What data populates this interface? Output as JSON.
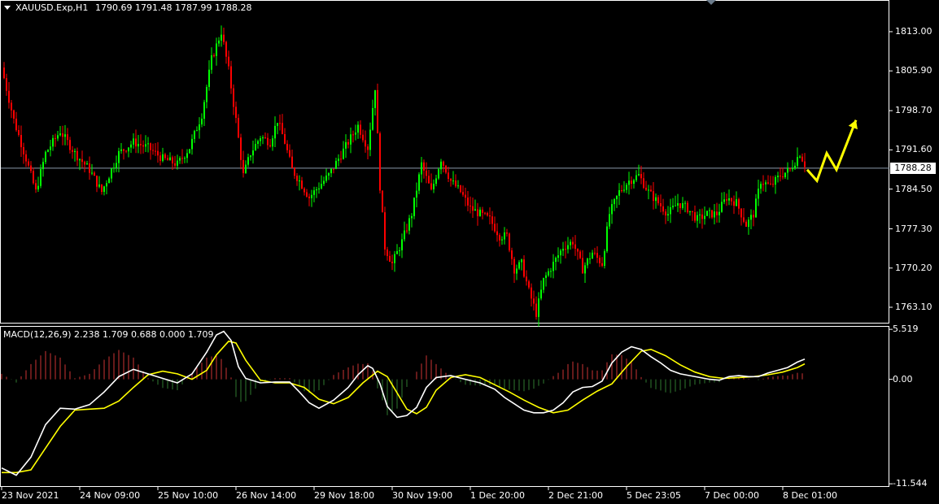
{
  "main_header": {
    "symbol": "XAUUSD.Exp,H1",
    "ohlc": "1790.69 1791.48 1787.99 1788.28"
  },
  "macd_header": {
    "text": "MACD(12,26,9) 2.238 1.709 0.688 0.000 1.709"
  },
  "current_price_label": "1788.28",
  "colors": {
    "background": "#000000",
    "bull_candle": "#00ff00",
    "bear_candle": "#ff0000",
    "macd_line": "#ffffff",
    "signal_line": "#ffff00",
    "hist_pos": "#cc3333",
    "hist_neg": "#2f7a2f",
    "grid_frame": "#ffffff",
    "forecast_arrow": "#ffff00"
  },
  "chart_data": [
    {
      "type": "candlestick",
      "symbol": "XAUUSD.Exp",
      "timeframe": "H1",
      "y_ticks": [
        "1813.00",
        "1805.90",
        "1798.70",
        "1791.60",
        "1784.50",
        "1777.30",
        "1770.20",
        "1763.10"
      ],
      "ylim": [
        1760.3,
        1818.0
      ],
      "x_ticks": [
        "23 Nov 2021",
        "24 Nov 09:00",
        "25 Nov 10:00",
        "26 Nov 14:00",
        "29 Nov 18:00",
        "30 Nov 19:00",
        "1 Dec 20:00",
        "2 Dec 21:00",
        "5 Dec 23:05",
        "7 Dec 00:00",
        "8 Dec 01:00"
      ],
      "current_price": 1788.28,
      "close_path": [
        {
          "bar": 0,
          "price": 1806.5
        },
        {
          "bar": 5,
          "price": 1797
        },
        {
          "bar": 10,
          "price": 1790
        },
        {
          "bar": 14,
          "price": 1784
        },
        {
          "bar": 18,
          "price": 1791
        },
        {
          "bar": 24,
          "price": 1795
        },
        {
          "bar": 30,
          "price": 1791
        },
        {
          "bar": 36,
          "price": 1788
        },
        {
          "bar": 41,
          "price": 1784
        },
        {
          "bar": 44,
          "price": 1787
        },
        {
          "bar": 48,
          "price": 1791
        },
        {
          "bar": 54,
          "price": 1793
        },
        {
          "bar": 60,
          "price": 1792
        },
        {
          "bar": 66,
          "price": 1790
        },
        {
          "bar": 72,
          "price": 1789
        },
        {
          "bar": 77,
          "price": 1792
        },
        {
          "bar": 82,
          "price": 1798
        },
        {
          "bar": 86,
          "price": 1808
        },
        {
          "bar": 90,
          "price": 1813
        },
        {
          "bar": 93,
          "price": 1806
        },
        {
          "bar": 96,
          "price": 1797
        },
        {
          "bar": 99,
          "price": 1787
        },
        {
          "bar": 102,
          "price": 1791
        },
        {
          "bar": 106,
          "price": 1794
        },
        {
          "bar": 110,
          "price": 1793
        },
        {
          "bar": 113,
          "price": 1797
        },
        {
          "bar": 116,
          "price": 1793
        },
        {
          "bar": 119,
          "price": 1788
        },
        {
          "bar": 122,
          "price": 1786
        },
        {
          "bar": 126,
          "price": 1783
        },
        {
          "bar": 130,
          "price": 1785
        },
        {
          "bar": 134,
          "price": 1787
        },
        {
          "bar": 138,
          "price": 1790
        },
        {
          "bar": 142,
          "price": 1793
        },
        {
          "bar": 146,
          "price": 1796
        },
        {
          "bar": 150,
          "price": 1792
        },
        {
          "bar": 153,
          "price": 1803
        },
        {
          "bar": 155,
          "price": 1785
        },
        {
          "bar": 157,
          "price": 1774
        },
        {
          "bar": 160,
          "price": 1771
        },
        {
          "bar": 164,
          "price": 1775
        },
        {
          "bar": 168,
          "price": 1780
        },
        {
          "bar": 172,
          "price": 1789
        },
        {
          "bar": 176,
          "price": 1784
        },
        {
          "bar": 180,
          "price": 1790
        },
        {
          "bar": 184,
          "price": 1786
        },
        {
          "bar": 188,
          "price": 1784
        },
        {
          "bar": 192,
          "price": 1781
        },
        {
          "bar": 196,
          "price": 1780
        },
        {
          "bar": 200,
          "price": 1779
        },
        {
          "bar": 204,
          "price": 1776
        },
        {
          "bar": 207,
          "price": 1776
        },
        {
          "bar": 210,
          "price": 1770
        },
        {
          "bar": 213,
          "price": 1771
        },
        {
          "bar": 216,
          "price": 1766
        },
        {
          "bar": 219,
          "price": 1762
        },
        {
          "bar": 222,
          "price": 1768
        },
        {
          "bar": 226,
          "price": 1771
        },
        {
          "bar": 230,
          "price": 1774
        },
        {
          "bar": 234,
          "price": 1775
        },
        {
          "bar": 238,
          "price": 1770
        },
        {
          "bar": 242,
          "price": 1773
        },
        {
          "bar": 246,
          "price": 1771
        },
        {
          "bar": 249,
          "price": 1780
        },
        {
          "bar": 253,
          "price": 1784
        },
        {
          "bar": 257,
          "price": 1786
        },
        {
          "bar": 261,
          "price": 1787
        },
        {
          "bar": 265,
          "price": 1784
        },
        {
          "bar": 269,
          "price": 1782
        },
        {
          "bar": 273,
          "price": 1780
        },
        {
          "bar": 277,
          "price": 1782
        },
        {
          "bar": 281,
          "price": 1781
        },
        {
          "bar": 285,
          "price": 1779
        },
        {
          "bar": 289,
          "price": 1780
        },
        {
          "bar": 293,
          "price": 1780
        },
        {
          "bar": 297,
          "price": 1783
        },
        {
          "bar": 301,
          "price": 1782
        },
        {
          "bar": 305,
          "price": 1778
        },
        {
          "bar": 308,
          "price": 1780
        },
        {
          "bar": 311,
          "price": 1786
        },
        {
          "bar": 315,
          "price": 1785
        },
        {
          "bar": 319,
          "price": 1787
        },
        {
          "bar": 323,
          "price": 1788
        },
        {
          "bar": 327,
          "price": 1791
        },
        {
          "bar": 329,
          "price": 1789
        }
      ],
      "forecast_arrow": [
        {
          "bar": 330,
          "price": 1788
        },
        {
          "bar": 334,
          "price": 1786
        },
        {
          "bar": 338,
          "price": 1791
        },
        {
          "bar": 342,
          "price": 1788
        },
        {
          "bar": 350,
          "price": 1797
        }
      ]
    },
    {
      "type": "macd",
      "name": "MACD(12,26,9)",
      "values": {
        "macd": 2.238,
        "signal": 1.709,
        "histogram": 0.688,
        "level": 0.0,
        "last": 1.709
      },
      "y_ticks": [
        "5.519",
        "0.00",
        "-11.544"
      ],
      "ylim": [
        -11.8,
        5.8
      ],
      "macd_path": [
        {
          "bar": 0,
          "v": -9.8
        },
        {
          "bar": 6,
          "v": -10.6
        },
        {
          "bar": 12,
          "v": -8.6
        },
        {
          "bar": 18,
          "v": -5.0
        },
        {
          "bar": 24,
          "v": -3.2
        },
        {
          "bar": 30,
          "v": -3.3
        },
        {
          "bar": 36,
          "v": -2.8
        },
        {
          "bar": 42,
          "v": -1.4
        },
        {
          "bar": 48,
          "v": 0.3
        },
        {
          "bar": 54,
          "v": 1.1
        },
        {
          "bar": 60,
          "v": 0.6
        },
        {
          "bar": 66,
          "v": 0.1
        },
        {
          "bar": 72,
          "v": -0.4
        },
        {
          "bar": 78,
          "v": 0.6
        },
        {
          "bar": 84,
          "v": 3.0
        },
        {
          "bar": 88,
          "v": 4.9
        },
        {
          "bar": 91,
          "v": 5.3
        },
        {
          "bar": 94,
          "v": 4.3
        },
        {
          "bar": 97,
          "v": 1.4
        },
        {
          "bar": 100,
          "v": 0.1
        },
        {
          "bar": 106,
          "v": -0.4
        },
        {
          "bar": 112,
          "v": -0.3
        },
        {
          "bar": 118,
          "v": -0.3
        },
        {
          "bar": 122,
          "v": -1.4
        },
        {
          "bar": 126,
          "v": -2.6
        },
        {
          "bar": 130,
          "v": -3.2
        },
        {
          "bar": 136,
          "v": -2.3
        },
        {
          "bar": 142,
          "v": -0.9
        },
        {
          "bar": 146,
          "v": 0.5
        },
        {
          "bar": 150,
          "v": 1.5
        },
        {
          "bar": 152,
          "v": 1.2
        },
        {
          "bar": 155,
          "v": -0.5
        },
        {
          "bar": 158,
          "v": -3.0
        },
        {
          "bar": 162,
          "v": -4.2
        },
        {
          "bar": 166,
          "v": -4.0
        },
        {
          "bar": 170,
          "v": -3.1
        },
        {
          "bar": 174,
          "v": -0.9
        },
        {
          "bar": 178,
          "v": 0.2
        },
        {
          "bar": 184,
          "v": 0.4
        },
        {
          "bar": 190,
          "v": 0.0
        },
        {
          "bar": 196,
          "v": -0.4
        },
        {
          "bar": 202,
          "v": -1.1
        },
        {
          "bar": 206,
          "v": -2.0
        },
        {
          "bar": 210,
          "v": -2.7
        },
        {
          "bar": 214,
          "v": -3.4
        },
        {
          "bar": 218,
          "v": -3.7
        },
        {
          "bar": 222,
          "v": -3.7
        },
        {
          "bar": 226,
          "v": -3.4
        },
        {
          "bar": 230,
          "v": -2.6
        },
        {
          "bar": 234,
          "v": -1.4
        },
        {
          "bar": 238,
          "v": -0.9
        },
        {
          "bar": 242,
          "v": -0.8
        },
        {
          "bar": 246,
          "v": -0.2
        },
        {
          "bar": 250,
          "v": 1.8
        },
        {
          "bar": 254,
          "v": 3.0
        },
        {
          "bar": 258,
          "v": 3.6
        },
        {
          "bar": 262,
          "v": 3.3
        },
        {
          "bar": 266,
          "v": 2.5
        },
        {
          "bar": 270,
          "v": 1.8
        },
        {
          "bar": 274,
          "v": 1.0
        },
        {
          "bar": 278,
          "v": 0.6
        },
        {
          "bar": 282,
          "v": 0.4
        },
        {
          "bar": 286,
          "v": 0.2
        },
        {
          "bar": 290,
          "v": 0.0
        },
        {
          "bar": 294,
          "v": -0.1
        },
        {
          "bar": 298,
          "v": 0.3
        },
        {
          "bar": 302,
          "v": 0.4
        },
        {
          "bar": 306,
          "v": 0.3
        },
        {
          "bar": 310,
          "v": 0.3
        },
        {
          "bar": 314,
          "v": 0.7
        },
        {
          "bar": 318,
          "v": 1.0
        },
        {
          "bar": 322,
          "v": 1.3
        },
        {
          "bar": 326,
          "v": 1.9
        },
        {
          "bar": 329,
          "v": 2.238
        }
      ],
      "signal_path": [
        {
          "bar": 0,
          "v": -10.3
        },
        {
          "bar": 6,
          "v": -10.3
        },
        {
          "bar": 12,
          "v": -10.0
        },
        {
          "bar": 18,
          "v": -7.6
        },
        {
          "bar": 24,
          "v": -5.2
        },
        {
          "bar": 30,
          "v": -3.4
        },
        {
          "bar": 36,
          "v": -3.3
        },
        {
          "bar": 42,
          "v": -3.2
        },
        {
          "bar": 48,
          "v": -2.4
        },
        {
          "bar": 54,
          "v": -0.9
        },
        {
          "bar": 60,
          "v": 0.5
        },
        {
          "bar": 66,
          "v": 0.9
        },
        {
          "bar": 72,
          "v": 0.6
        },
        {
          "bar": 78,
          "v": 0.0
        },
        {
          "bar": 84,
          "v": 1.0
        },
        {
          "bar": 88,
          "v": 2.7
        },
        {
          "bar": 93,
          "v": 4.2
        },
        {
          "bar": 96,
          "v": 4.0
        },
        {
          "bar": 100,
          "v": 2.1
        },
        {
          "bar": 106,
          "v": -0.1
        },
        {
          "bar": 112,
          "v": -0.4
        },
        {
          "bar": 118,
          "v": -0.4
        },
        {
          "bar": 124,
          "v": -0.9
        },
        {
          "bar": 130,
          "v": -2.2
        },
        {
          "bar": 136,
          "v": -2.7
        },
        {
          "bar": 142,
          "v": -2.0
        },
        {
          "bar": 148,
          "v": -0.4
        },
        {
          "bar": 154,
          "v": 0.9
        },
        {
          "bar": 158,
          "v": 0.3
        },
        {
          "bar": 162,
          "v": -1.5
        },
        {
          "bar": 166,
          "v": -3.3
        },
        {
          "bar": 170,
          "v": -3.8
        },
        {
          "bar": 174,
          "v": -3.1
        },
        {
          "bar": 178,
          "v": -1.2
        },
        {
          "bar": 184,
          "v": 0.2
        },
        {
          "bar": 190,
          "v": 0.5
        },
        {
          "bar": 196,
          "v": 0.2
        },
        {
          "bar": 202,
          "v": -0.6
        },
        {
          "bar": 208,
          "v": -1.4
        },
        {
          "bar": 214,
          "v": -2.3
        },
        {
          "bar": 220,
          "v": -3.1
        },
        {
          "bar": 226,
          "v": -3.7
        },
        {
          "bar": 232,
          "v": -3.4
        },
        {
          "bar": 238,
          "v": -2.3
        },
        {
          "bar": 244,
          "v": -1.3
        },
        {
          "bar": 250,
          "v": -0.5
        },
        {
          "bar": 256,
          "v": 1.4
        },
        {
          "bar": 262,
          "v": 3.1
        },
        {
          "bar": 266,
          "v": 3.3
        },
        {
          "bar": 272,
          "v": 2.6
        },
        {
          "bar": 278,
          "v": 1.6
        },
        {
          "bar": 284,
          "v": 0.8
        },
        {
          "bar": 290,
          "v": 0.3
        },
        {
          "bar": 296,
          "v": 0.1
        },
        {
          "bar": 302,
          "v": 0.2
        },
        {
          "bar": 308,
          "v": 0.3
        },
        {
          "bar": 314,
          "v": 0.5
        },
        {
          "bar": 320,
          "v": 0.8
        },
        {
          "bar": 326,
          "v": 1.3
        },
        {
          "bar": 329,
          "v": 1.709
        }
      ]
    }
  ]
}
